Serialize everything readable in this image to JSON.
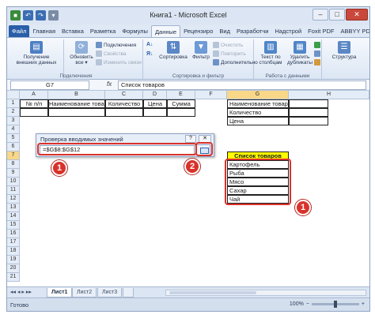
{
  "window": {
    "title": "Книга1 - Microsoft Excel",
    "qat": [
      "save-icon",
      "undo-icon",
      "redo-icon",
      "dropdown-icon"
    ],
    "controls": [
      "–",
      "□",
      "✕"
    ]
  },
  "ribbon": {
    "tabs": [
      "Файл",
      "Главная",
      "Вставка",
      "Разметка",
      "Формулы",
      "Данные",
      "Рецензиро",
      "Вид",
      "Разработчи",
      "Надстрой",
      "Foxit PDF",
      "ABBYY PDF"
    ],
    "active_tab": "Данные",
    "groups": {
      "external": {
        "button": "Получение внешних данных",
        "button_line1": "Получение",
        "button_line2": "внешних данных",
        "label": "Подключения"
      },
      "connections": {
        "refresh_line1": "Обновить",
        "refresh_line2": "все ▾",
        "items": [
          "Подключения",
          "Свойства",
          "Изменить связи"
        ]
      },
      "sort": {
        "sort_button": "Сортировка",
        "filter_button": "Фильтр",
        "items": [
          "Очистить",
          "Повторить",
          "Дополнительно"
        ],
        "label": "Сортировка и фильтр"
      },
      "tools": {
        "text_to_cols_line1": "Текст по",
        "text_to_cols_line2": "столбцам",
        "remove_dup_line1": "Удалить",
        "remove_dup_line2": "дубликаты",
        "label": "Работа с данными"
      },
      "outline": {
        "button": "Структура"
      }
    }
  },
  "formula_bar": {
    "name_box": "G7",
    "fx": "fx",
    "content": "Список товаров"
  },
  "grid": {
    "columns": [
      "A",
      "B",
      "C",
      "D",
      "E",
      "F",
      "G",
      "H"
    ],
    "rows": [
      "1",
      "2",
      "3",
      "4",
      "5",
      "6",
      "7",
      "8",
      "9",
      "10",
      "11",
      "12",
      "13",
      "14",
      "15",
      "16",
      "17",
      "18",
      "19",
      "20",
      "21"
    ],
    "header_row": [
      "№ п/п",
      "Наименование товара",
      "Количество",
      "Цена",
      "Сумма"
    ],
    "g_labels": [
      "Наименование товара",
      "Количество",
      "Цена"
    ],
    "list_title": "Список товаров",
    "products": [
      "Картофель",
      "Рыба",
      "Мясо",
      "Сахар",
      "Чай"
    ]
  },
  "dialog": {
    "title": "Проверка вводимых значений",
    "help": "?",
    "close": "✕",
    "input_value": "=$G$8:$G$12"
  },
  "annotations": [
    "1",
    "2",
    "1"
  ],
  "sheets": {
    "tabs": [
      "Лист1",
      "Лист2",
      "Лист3"
    ],
    "active": "Лист1",
    "nav": "◂◂ ◂ ▸ ▸▸"
  },
  "status": {
    "text": "Готово",
    "zoom": "100%"
  },
  "colors": {
    "file_tab": "#2a5ea8",
    "list_title_fill": "#ffff00",
    "annotation_red": "#d9322a",
    "selected_header": "#f9d788"
  }
}
